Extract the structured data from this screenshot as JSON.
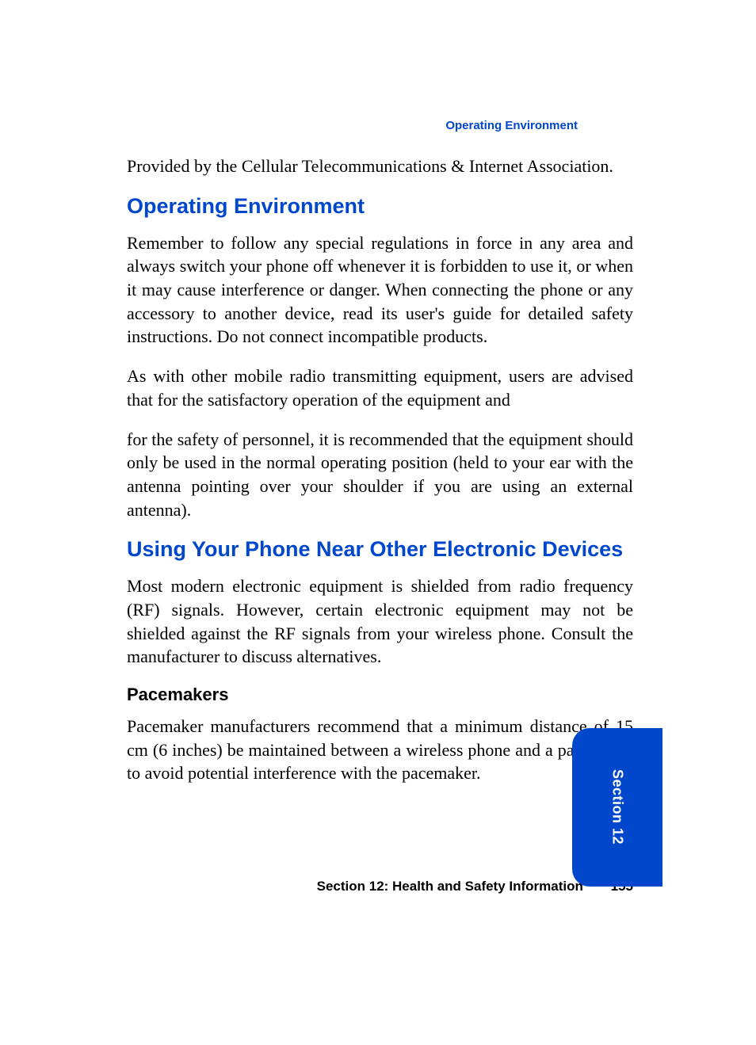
{
  "header": {
    "label": "Operating Environment"
  },
  "body": {
    "intro": "Provided by the Cellular Telecommunications & Internet Association.",
    "heading1": "Operating Environment",
    "para1": "Remember to follow any special regulations in force in any area and always switch your phone off whenever it is forbidden to use it, or when it may cause interference or danger. When connecting the phone or any accessory to another device, read its user's guide for detailed safety instructions. Do not connect incompatible products.",
    "para2": "As with other mobile radio transmitting equipment, users are advised that for the satisfactory operation of the equipment and",
    "para3": "for the safety of personnel, it is recommended that the equipment should only be used in the normal operating position (held to your ear with the antenna pointing over your shoulder if you are using an external antenna).",
    "heading2": "Using Your Phone Near Other Electronic Devices",
    "para4": "Most modern electronic equipment is shielded from radio frequency (RF) signals. However, certain electronic equipment may not be shielded against the RF signals from your wireless phone. Consult the manufacturer to discuss alternatives.",
    "subheading1": "Pacemakers",
    "para5": "Pacemaker manufacturers recommend that a minimum distance of 15 cm (6 inches) be maintained between a wireless phone and a pacemaker to avoid potential interference with the pacemaker."
  },
  "footer": {
    "section": "Section 12: Health and Safety Information",
    "page": "155"
  },
  "tab": {
    "label": "Section 12"
  }
}
